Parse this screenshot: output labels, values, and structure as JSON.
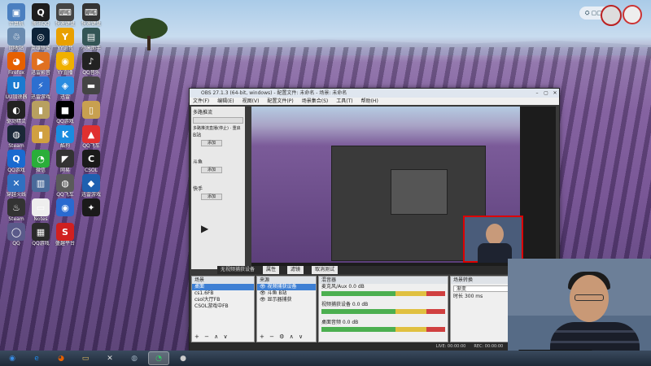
{
  "desktop": {
    "icons": [
      {
        "label": "计算机",
        "glyph": "▣",
        "color": "#4a7fc0"
      },
      {
        "label": "腾讯QQ",
        "glyph": "Q",
        "color": "#1d1d1d"
      },
      {
        "label": "快速键盘",
        "glyph": "⌨",
        "color": "#444"
      },
      {
        "label": "快速键盘",
        "glyph": "⌨",
        "color": "#333"
      },
      {
        "label": "回收站",
        "glyph": "♲",
        "color": "#6a8bb0"
      },
      {
        "label": "英雄联盟",
        "glyph": "◎",
        "color": "#0c2238"
      },
      {
        "label": "YY语音",
        "glyph": "Y",
        "color": "#e8a000"
      },
      {
        "label": "小米助手",
        "glyph": "▤",
        "color": "#355"
      },
      {
        "label": "Firefox",
        "glyph": "◕",
        "color": "#e66000"
      },
      {
        "label": "迅雷影音",
        "glyph": "▶",
        "color": "#e07020"
      },
      {
        "label": "YY直播",
        "glyph": "◉",
        "color": "#f0b000"
      },
      {
        "label": "QQ音乐",
        "glyph": "♪",
        "color": "#222"
      },
      {
        "label": "UU加速器",
        "glyph": "U",
        "color": "#1a7ad0"
      },
      {
        "label": "迅雷游戏",
        "glyph": "⚡",
        "color": "#2d6fd0"
      },
      {
        "label": "迅雷",
        "glyph": "◈",
        "color": "#2a8ce0"
      },
      {
        "label": "",
        "glyph": "▬",
        "color": "#444"
      },
      {
        "label": "驱动精灵",
        "glyph": "◐",
        "color": "#222"
      },
      {
        "label": "",
        "glyph": "▮",
        "color": "#b8a060"
      },
      {
        "label": "QQ游戏",
        "glyph": "■",
        "color": "#000"
      },
      {
        "label": "",
        "glyph": "▯",
        "color": "#c8a050"
      },
      {
        "label": "Steam",
        "glyph": "◍",
        "color": "#1b2838"
      },
      {
        "label": "",
        "glyph": "▮",
        "color": "#d0a040"
      },
      {
        "label": "酷狗",
        "glyph": "K",
        "color": "#1a8ce0"
      },
      {
        "label": "QQ飞车",
        "glyph": "▲",
        "color": "#e03030"
      },
      {
        "label": "QQ游戏",
        "glyph": "Q",
        "color": "#1a6ad0"
      },
      {
        "label": "微信",
        "glyph": "◔",
        "color": "#2aae3a"
      },
      {
        "label": "网易",
        "glyph": "◤",
        "color": "#333"
      },
      {
        "label": "CSOL",
        "glyph": "C",
        "color": "#1a1a1a"
      },
      {
        "label": "穿越火线",
        "glyph": "✕",
        "color": "#3070c0"
      },
      {
        "label": "",
        "glyph": "▥",
        "color": "#4a6a9a"
      },
      {
        "label": "QQ飞车",
        "glyph": "◍",
        "color": "#5a5a5a"
      },
      {
        "label": "迅雷游戏",
        "glyph": "◆",
        "color": "#1e60b0"
      },
      {
        "label": "Steam",
        "glyph": "♨",
        "color": "#333"
      },
      {
        "label": "Notes",
        "glyph": "▭",
        "color": "#eee"
      },
      {
        "label": "",
        "glyph": "◉",
        "color": "#2a6ad0"
      },
      {
        "label": "",
        "glyph": "✦",
        "color": "#1a1a1a"
      },
      {
        "label": "QQ",
        "glyph": "◯",
        "color": "#5a5a8a"
      },
      {
        "label": "QQ游戏",
        "glyph": "▦",
        "color": "#2a2a2a"
      },
      {
        "label": "盛趣平台",
        "glyph": "S",
        "color": "#d02020"
      }
    ]
  },
  "tray": {
    "widget_label": "⛭ ▢▢▢▢"
  },
  "obs": {
    "title": "OBS 27.1.3 (64-bit, windows) - 配置文件: 未命名 - 场景: 未命名",
    "menu": [
      "文件(F)",
      "编辑(E)",
      "视图(V)",
      "配置文件(P)",
      "场景集合(S)",
      "工具(T)",
      "帮助(H)"
    ],
    "left_panel": {
      "heading": "多路推流",
      "sub": "多路推流直播(停止) · 重启",
      "labels": [
        "B站",
        "斗鱼",
        "快手"
      ],
      "button": "添加"
    },
    "bar": {
      "source_label": "无视频捕获设备",
      "properties": "属性",
      "filters": "滤镜",
      "open_settings": "取消测试"
    },
    "scenes": {
      "heading": "场景",
      "items": [
        "桌面",
        "cs1.6FB",
        "csol大厅FB",
        "CSOL游戏中FB"
      ]
    },
    "sources": {
      "heading": "来源",
      "items": [
        "视频捕获设备",
        "斗鱼 B站",
        "显示器捕获"
      ]
    },
    "mixer": {
      "heading": "混音器",
      "channels": [
        "麦克风/Aux",
        "视频捕获设备",
        "桌面音频"
      ],
      "db": "0.0 dB"
    },
    "transition": {
      "heading": "场景转换",
      "mode": "渐变",
      "duration_label": "时长",
      "duration": "300 ms"
    },
    "status": [
      "LIVE: 00:00:00",
      "REC: 00:00:00",
      "CPU: 0.4%, 30.00 fps"
    ]
  },
  "taskbar": {
    "items": [
      {
        "name": "start-button",
        "glyph": "◉",
        "color": "#3a8ee6"
      },
      {
        "name": "taskbar-ie",
        "glyph": "e",
        "color": "#1e88e5"
      },
      {
        "name": "taskbar-firefox",
        "glyph": "◕",
        "color": "#e66000"
      },
      {
        "name": "taskbar-explorer",
        "glyph": "▭",
        "color": "#e8c060"
      },
      {
        "name": "taskbar-csol",
        "glyph": "✕",
        "color": "#ddd"
      },
      {
        "name": "taskbar-steam",
        "glyph": "◍",
        "color": "#9ab"
      },
      {
        "name": "taskbar-app",
        "glyph": "◔",
        "color": "#3c6"
      },
      {
        "name": "taskbar-obs",
        "glyph": "●",
        "color": "#ccc"
      }
    ]
  }
}
